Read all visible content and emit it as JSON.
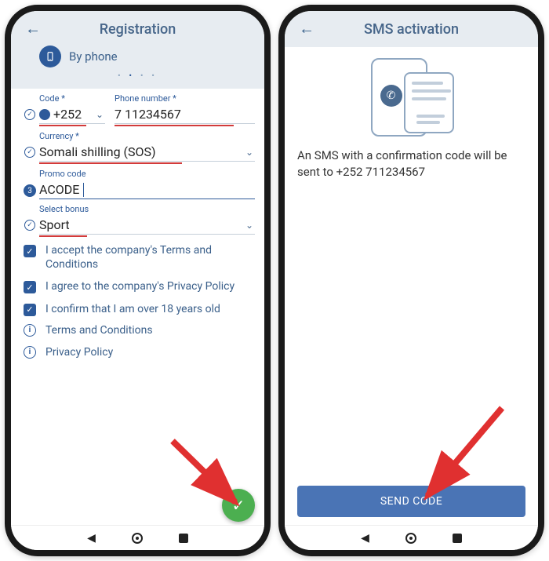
{
  "left": {
    "title": "Registration",
    "by_phone": "By phone",
    "code_label": "Code *",
    "code_value": "+252",
    "phone_label": "Phone number *",
    "phone_value": "7 11234567",
    "currency_label": "Currency *",
    "currency_value": "Somali shilling (SOS)",
    "promo_label": "Promo code",
    "promo_value": "ACODE",
    "bonus_label": "Select bonus",
    "bonus_value": "Sport",
    "step_number": "3",
    "agree_terms": "I accept the company's Terms and Conditions",
    "agree_privacy": "I agree to the company's Privacy Policy",
    "agree_age": "I confirm that I am over 18 years old",
    "link_terms": "Terms and Conditions",
    "link_privacy": "Privacy Policy"
  },
  "right": {
    "title": "SMS activation",
    "message": "An SMS with a confirmation code will be sent to +252 711234567",
    "button": "SEND CODE"
  }
}
